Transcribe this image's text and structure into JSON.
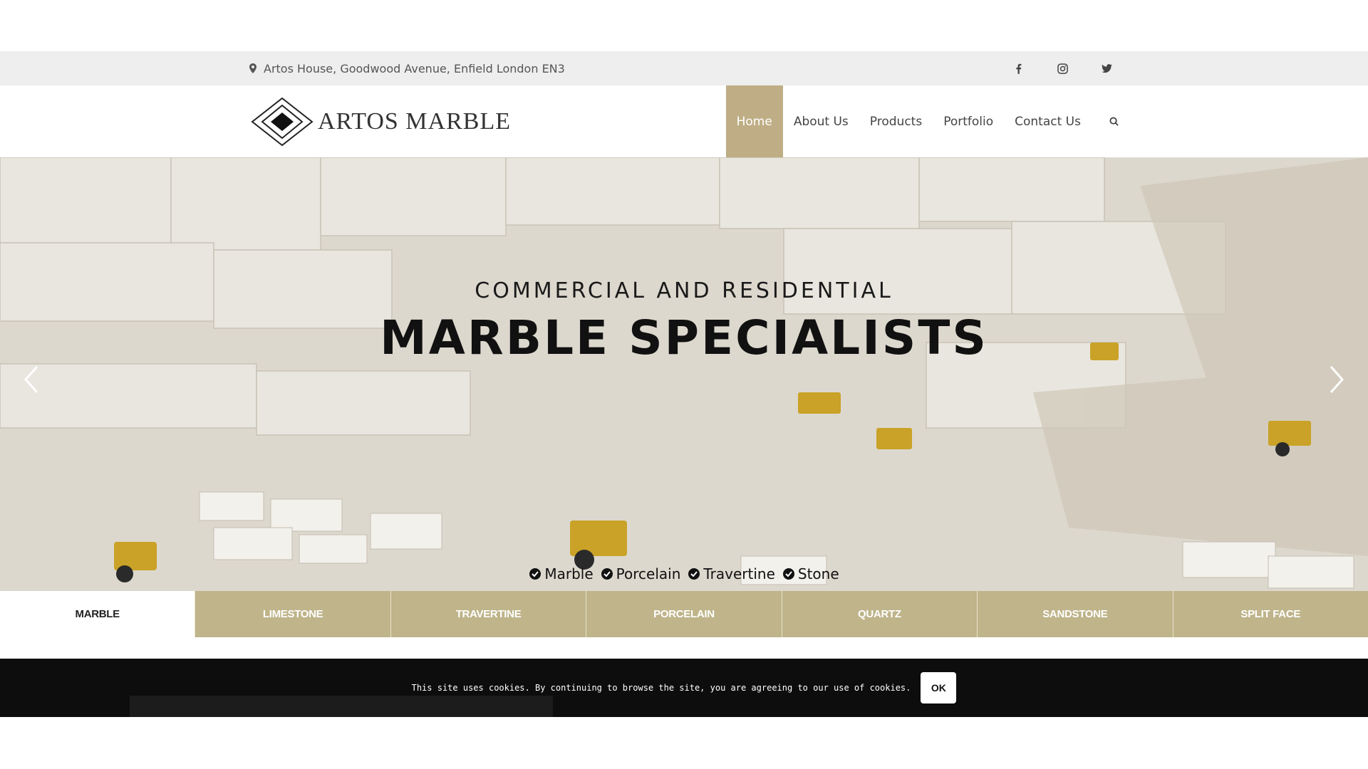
{
  "topbar": {
    "address": "Artos House, Goodwood Avenue, Enfield London EN3",
    "socials": [
      "facebook-icon",
      "instagram-icon",
      "twitter-icon"
    ]
  },
  "brand": {
    "name": "ARTOS MARBLE",
    "accent": "#bfae85",
    "tab_color": "#bfb48a"
  },
  "nav": {
    "items": [
      {
        "label": "Home",
        "active": true
      },
      {
        "label": "About Us"
      },
      {
        "label": "Products"
      },
      {
        "label": "Portfolio"
      },
      {
        "label": "Contact Us"
      }
    ],
    "search_icon": "search-icon"
  },
  "hero": {
    "subtitle": "COMMERCIAL AND RESIDENTIAL",
    "title": "MARBLE SPECIALISTS",
    "checks": [
      "Marble",
      "Porcelain",
      "Travertine",
      "Stone"
    ]
  },
  "tabs": [
    {
      "label": "MARBLE",
      "active": true
    },
    {
      "label": "LIMESTONE"
    },
    {
      "label": "TRAVERTINE"
    },
    {
      "label": "PORCELAIN"
    },
    {
      "label": "QUARTZ"
    },
    {
      "label": "SANDSTONE"
    },
    {
      "label": "SPLIT FACE"
    }
  ],
  "cookie": {
    "message": "This site uses cookies. By continuing to browse the site, you are agreeing to our use of cookies.",
    "ok_label": "OK"
  }
}
